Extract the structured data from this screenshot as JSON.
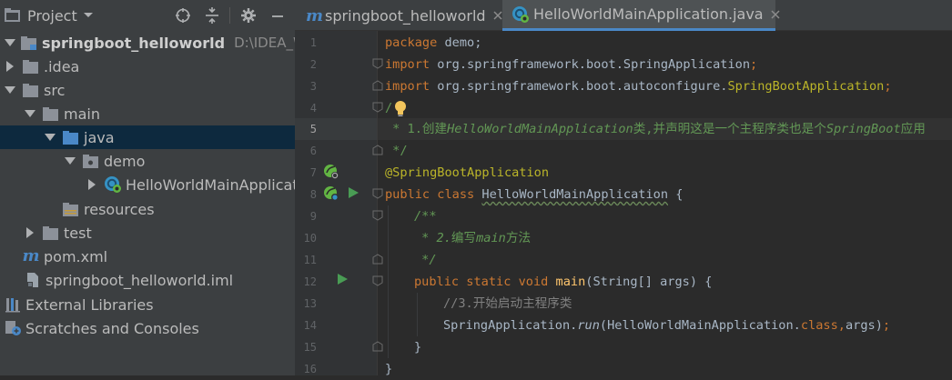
{
  "project_panel": {
    "title": "Project",
    "tools": [
      "crosshair-icon",
      "collapse-all-icon",
      "gear-icon",
      "minimize-icon"
    ],
    "tree": [
      {
        "label": "springboot_helloworld",
        "path": "D:\\IDEA_Workspace",
        "icon": "module-folder-icon",
        "expanded": true,
        "bold": true
      },
      {
        "label": ".idea",
        "icon": "folder-icon",
        "expanded": false
      },
      {
        "label": "src",
        "icon": "folder-icon",
        "expanded": true
      },
      {
        "label": "main",
        "icon": "folder-icon",
        "expanded": true
      },
      {
        "label": "java",
        "icon": "source-folder-icon",
        "expanded": true,
        "selected": true
      },
      {
        "label": "demo",
        "icon": "package-icon",
        "expanded": true
      },
      {
        "label": "HelloWorldMainApplication",
        "icon": "spring-class-icon",
        "expanded": false
      },
      {
        "label": "resources",
        "icon": "resources-folder-icon"
      },
      {
        "label": "test",
        "icon": "folder-icon",
        "expanded": false
      },
      {
        "label": "pom.xml",
        "icon": "maven-icon"
      },
      {
        "label": "springboot_helloworld.iml",
        "icon": "iml-file-icon"
      },
      {
        "label": "External Libraries",
        "icon": "libraries-icon"
      },
      {
        "label": "Scratches and Consoles",
        "icon": "scratches-icon"
      }
    ]
  },
  "tabs": [
    {
      "label": "springboot_helloworld",
      "icon": "maven-icon",
      "active": false
    },
    {
      "label": "HelloWorldMainApplication.java",
      "icon": "spring-class-icon",
      "active": true
    }
  ],
  "editor": {
    "current_line": 5,
    "line_numbers": [
      "1",
      "2",
      "3",
      "4",
      "5",
      "6",
      "7",
      "8",
      "9",
      "10",
      "11",
      "12",
      "13",
      "14",
      "15",
      "16"
    ],
    "code": {
      "l1_kw": "package",
      "l1_rest": " demo;",
      "l2_kw": "import",
      "l2_rest": " org.springframework.boot.SpringApplication",
      "l2_semi": ";",
      "l3_kw": "import",
      "l3_rest": " org.springframework.boot.autoconfigure.",
      "l3_anno": "SpringBootApplication",
      "l3_semi": ";",
      "l4_doc": "/",
      "l5_star": " * 1.",
      "l5_text_a": "创建",
      "l5_code_a": "HelloWorldMainApplication",
      "l5_text_b": "类,并声明这是一个主程序类也是个",
      "l5_code_b": "SpringBoot",
      "l5_text_c": "应用",
      "l6_doc": " */",
      "l7_anno": "@SpringBootApplication",
      "l8_kw": "public class",
      "l8_name": "HelloWorldMainApplication",
      "l8_rest": " {",
      "l9_doc": "/**",
      "l10_star": " * 2.",
      "l10_text": "编写",
      "l10_code": "main",
      "l10_text_b": "方法",
      "l11_doc": " */",
      "l12_kw": "public static void",
      "l12_fn": "main",
      "l12_rest": "(String[] args) {",
      "l13_cmt": "//3.开始启动主程序类",
      "l14_a": "SpringApplication.",
      "l14_run": "run",
      "l14_b": "(HelloWorldMainApplication.",
      "l14_class": "class",
      "l14_comma": ",",
      "l14_c": "args)",
      "l14_semi": ";",
      "l15": "}",
      "l16": "}"
    }
  },
  "colors": {
    "keyword": "#cc7832",
    "annotation": "#bbb529",
    "doc_comment": "#629755",
    "comment": "#808080",
    "function": "#ffc66d",
    "text": "#a9b7c6",
    "selection": "#0d293e",
    "tab_underline": "#4a88c7"
  }
}
